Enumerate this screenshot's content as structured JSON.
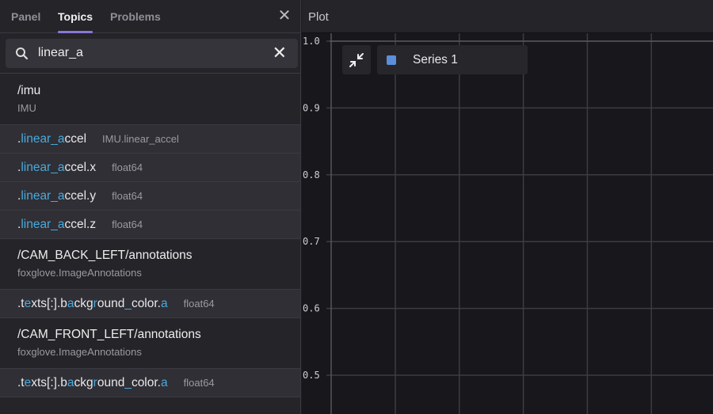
{
  "sidebar": {
    "tabs": [
      {
        "label": "Panel"
      },
      {
        "label": "Topics"
      },
      {
        "label": "Problems"
      }
    ],
    "active_tab": "Topics",
    "search": {
      "value": "linear_a",
      "placeholder": ""
    },
    "items": [
      {
        "kind": "topic",
        "name": "/imu",
        "type": "IMU"
      },
      {
        "kind": "field",
        "segments": [
          {
            "t": ".",
            "h": false
          },
          {
            "t": "linear_a",
            "h": true
          },
          {
            "t": "ccel",
            "h": false
          }
        ],
        "type": "IMU.linear_accel"
      },
      {
        "kind": "field",
        "segments": [
          {
            "t": ".",
            "h": false
          },
          {
            "t": "linear_a",
            "h": true
          },
          {
            "t": "ccel.x",
            "h": false
          }
        ],
        "type": "float64"
      },
      {
        "kind": "field",
        "segments": [
          {
            "t": ".",
            "h": false
          },
          {
            "t": "linear_a",
            "h": true
          },
          {
            "t": "ccel.y",
            "h": false
          }
        ],
        "type": "float64"
      },
      {
        "kind": "field",
        "segments": [
          {
            "t": ".",
            "h": false
          },
          {
            "t": "linear_a",
            "h": true
          },
          {
            "t": "ccel.z",
            "h": false
          }
        ],
        "type": "float64"
      },
      {
        "kind": "topic",
        "name": "/CAM_BACK_LEFT/annotations",
        "type": "foxglove.ImageAnnotations"
      },
      {
        "kind": "field",
        "segments": [
          {
            "t": ".t",
            "h": false
          },
          {
            "t": "e",
            "h": true
          },
          {
            "t": "xts[:].b",
            "h": false
          },
          {
            "t": "a",
            "h": true
          },
          {
            "t": "ckg",
            "h": false
          },
          {
            "t": "r",
            "h": true
          },
          {
            "t": "ound",
            "h": false
          },
          {
            "t": "_",
            "h": true
          },
          {
            "t": "color.",
            "h": false
          },
          {
            "t": "a",
            "h": true
          }
        ],
        "type": "float64"
      },
      {
        "kind": "topic",
        "name": "/CAM_FRONT_LEFT/annotations",
        "type": "foxglove.ImageAnnotations"
      },
      {
        "kind": "field",
        "segments": [
          {
            "t": ".t",
            "h": false
          },
          {
            "t": "e",
            "h": true
          },
          {
            "t": "xts[:].b",
            "h": false
          },
          {
            "t": "a",
            "h": true
          },
          {
            "t": "ckg",
            "h": false
          },
          {
            "t": "r",
            "h": true
          },
          {
            "t": "ound",
            "h": false
          },
          {
            "t": "_",
            "h": true
          },
          {
            "t": "color.",
            "h": false
          },
          {
            "t": "a",
            "h": true
          }
        ],
        "type": "float64"
      }
    ]
  },
  "plot": {
    "title": "Plot",
    "legend": [
      {
        "label": "Series 1",
        "color": "#5b8fd9"
      }
    ],
    "colors": {
      "highlight": "#4aa9dc",
      "tab_indicator": "#8a76d8"
    }
  },
  "chart_data": {
    "type": "line",
    "title": "",
    "series": [
      {
        "name": "Series 1",
        "values": []
      }
    ],
    "ylim": [
      0.45,
      1.0
    ],
    "yticks": [
      "1.0",
      "0.9",
      "0.8",
      "0.7",
      "0.6",
      "0.5"
    ],
    "grid": true,
    "legend": "top-left"
  }
}
